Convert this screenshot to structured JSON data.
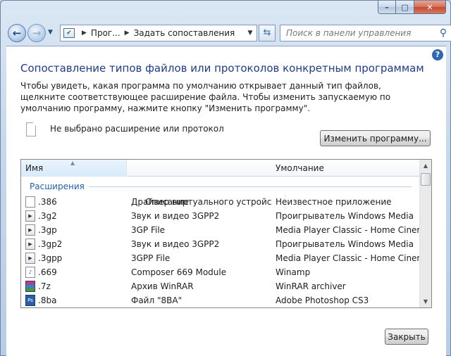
{
  "window": {
    "minimize_glyph": "–",
    "maximize_glyph": "□",
    "close_glyph": "✕"
  },
  "nav": {
    "address": {
      "segments": [
        "Прог...",
        "Задать сопоставления"
      ]
    },
    "search": {
      "placeholder": "Поиск в панели управления"
    }
  },
  "page": {
    "title": "Сопоставление типов файлов или протоколов конкретным программам",
    "description": "Чтобы увидеть, какая программа по умолчанию открывает данный тип файлов, щелкните соответствующее расширение файла. Чтобы изменить запускаемую по умолчанию программу, нажмите кнопку \"Изменить программу\".",
    "selection_text": "Не выбрано расширение или протокол",
    "change_button": "Изменить программу...",
    "close_button": "Закрыть",
    "help_glyph": "?"
  },
  "list": {
    "columns": [
      "Имя",
      "Описание",
      "Умолчание"
    ],
    "group_label": "Расширения",
    "rows": [
      {
        "name": ".386",
        "description": "Драйвер виртуального устройства",
        "default": "Неизвестное приложение",
        "icon": "blank-file-icon"
      },
      {
        "name": ".3g2",
        "description": "Звук и видео 3GPP2",
        "default": "Проигрыватель Windows Media",
        "icon": "media-file-icon"
      },
      {
        "name": ".3gp",
        "description": "3GP File",
        "default": "Media Player Classic - Home Cinema",
        "icon": "media-file-icon"
      },
      {
        "name": ".3gp2",
        "description": "Звук и видео 3GPP2",
        "default": "Проигрыватель Windows Media",
        "icon": "media-file-icon"
      },
      {
        "name": ".3gpp",
        "description": "3GPP File",
        "default": "Media Player Classic - Home Cinema",
        "icon": "media-file-icon"
      },
      {
        "name": ".669",
        "description": "Composer 669 Module",
        "default": "Winamp",
        "icon": "winamp-file-icon"
      },
      {
        "name": ".7z",
        "description": "Архив WinRAR",
        "default": "WinRAR archiver",
        "icon": "winrar-file-icon"
      },
      {
        "name": ".8ba",
        "description": "Файл \"8BA\"",
        "default": "Adobe Photoshop CS3",
        "icon": "photoshop-file-icon"
      }
    ]
  }
}
